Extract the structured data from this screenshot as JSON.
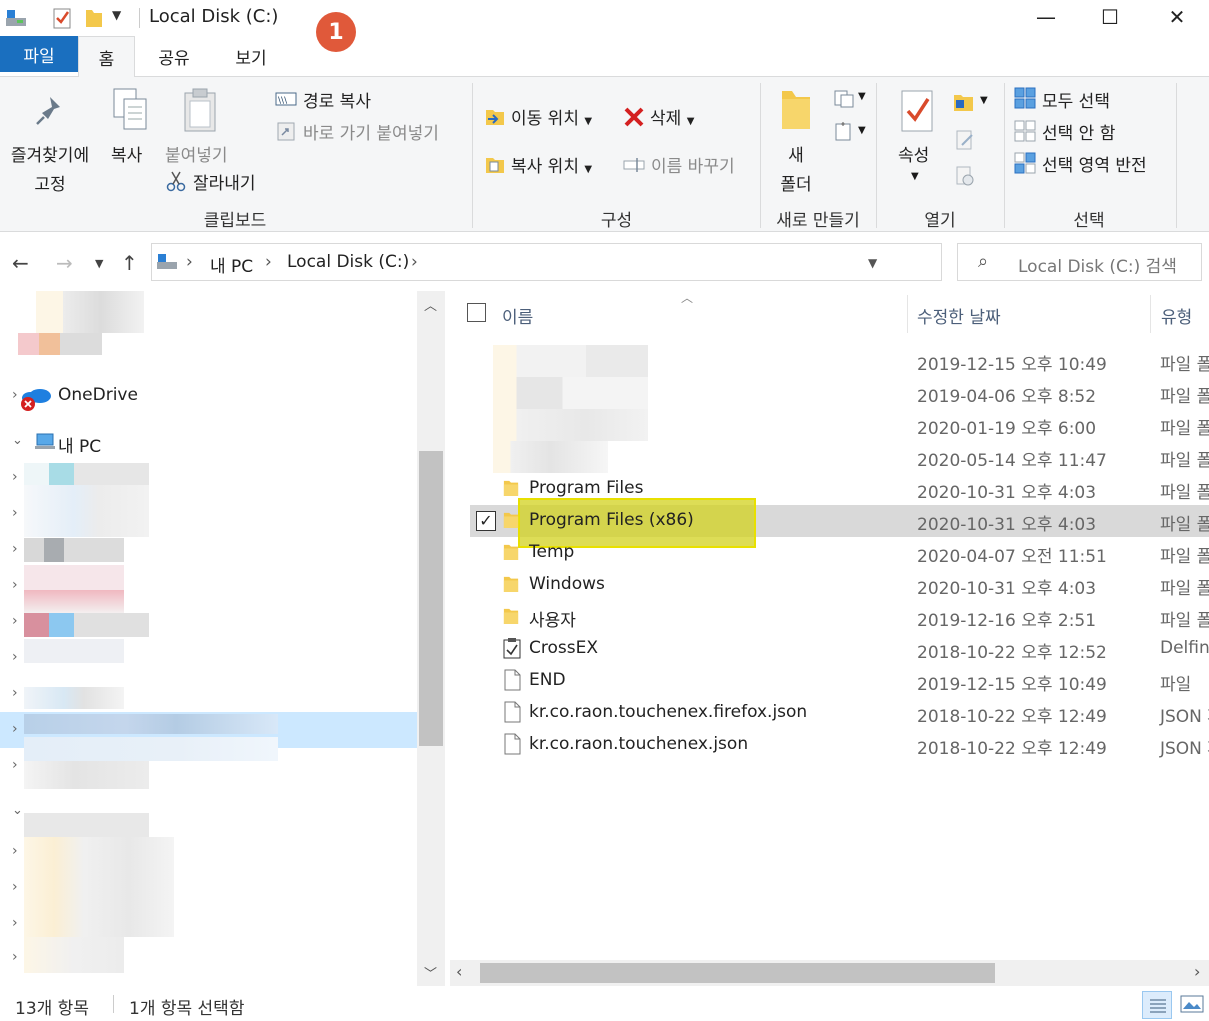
{
  "titlebar": {
    "title": "Local Disk (C:)",
    "badge": "1",
    "minimize_glyph": "—",
    "maximize_glyph": "☐",
    "close_glyph": "✕"
  },
  "tabs": [
    {
      "label": "파일"
    },
    {
      "label": "홈"
    },
    {
      "label": "공유"
    },
    {
      "label": "보기"
    }
  ],
  "ribbon": {
    "clipboard": {
      "pin_line1": "즐겨찾기에",
      "pin_line2": "고정",
      "copy": "복사",
      "paste": "붙여넣기",
      "copy_path": "경로 복사",
      "paste_shortcut": "바로 가기 붙여넣기",
      "cut": "잘라내기",
      "group": "클립보드"
    },
    "organize": {
      "move_to": "이동 위치",
      "copy_to": "복사 위치",
      "delete": "삭제",
      "rename": "이름 바꾸기",
      "group": "구성"
    },
    "new": {
      "new_folder_line1": "새",
      "new_folder_line2": "폴더",
      "group": "새로 만들기"
    },
    "open": {
      "properties": "속성",
      "group": "열기"
    },
    "select": {
      "select_all": "모두 선택",
      "select_none": "선택 안 함",
      "invert": "선택 영역 반전",
      "group": "선택"
    }
  },
  "address": {
    "crumbs": [
      "내 PC",
      "Local Disk (C:)"
    ],
    "search_placeholder": "Local Disk (C:) 검색"
  },
  "navpane": {
    "onedrive": "OneDrive",
    "thispc": "내 PC"
  },
  "columns": {
    "name": "이름",
    "date": "수정한 날짜",
    "type": "유형"
  },
  "files": [
    {
      "name": "",
      "date": "2019-12-15 오후 10:49",
      "type": "파일 폴"
    },
    {
      "name": "",
      "date": "2019-04-06 오후 8:52",
      "type": "파일 폴"
    },
    {
      "name": "",
      "date": "2020-01-19 오후 6:00",
      "type": "파일 폴"
    },
    {
      "name": "",
      "date": "2020-05-14 오후 11:47",
      "type": "파일 폴"
    },
    {
      "name": "Program Files",
      "date": "2020-10-31 오후 4:03",
      "type": "파일 폴"
    },
    {
      "name": "Program Files (x86)",
      "date": "2020-10-31 오후 4:03",
      "type": "파일 폴"
    },
    {
      "name": "Temp",
      "date": "2020-04-07 오전 11:51",
      "type": "파일 폴"
    },
    {
      "name": "Windows",
      "date": "2020-10-31 오후 4:03",
      "type": "파일 폴"
    },
    {
      "name": "사용자",
      "date": "2019-12-16 오후 2:51",
      "type": "파일 폴"
    },
    {
      "name": "CrossEX",
      "date": "2018-10-22 오후 12:52",
      "type": "Delfino"
    },
    {
      "name": "END",
      "date": "2019-12-15 오후 10:49",
      "type": "파일"
    },
    {
      "name": "kr.co.raon.touchenex.firefox.json",
      "date": "2018-10-22 오후 12:49",
      "type": "JSON 파"
    },
    {
      "name": "kr.co.raon.touchenex.json",
      "date": "2018-10-22 오후 12:49",
      "type": "JSON 파"
    }
  ],
  "status": {
    "count": "13개 항목",
    "selected": "1개 항목 선택함"
  },
  "colors": {
    "file_tab": "#1a6fbf",
    "highlight": "#d2d21e",
    "badge": "#e0593a",
    "selection": "#d9d9d9",
    "nav_selection": "#cce8ff"
  }
}
